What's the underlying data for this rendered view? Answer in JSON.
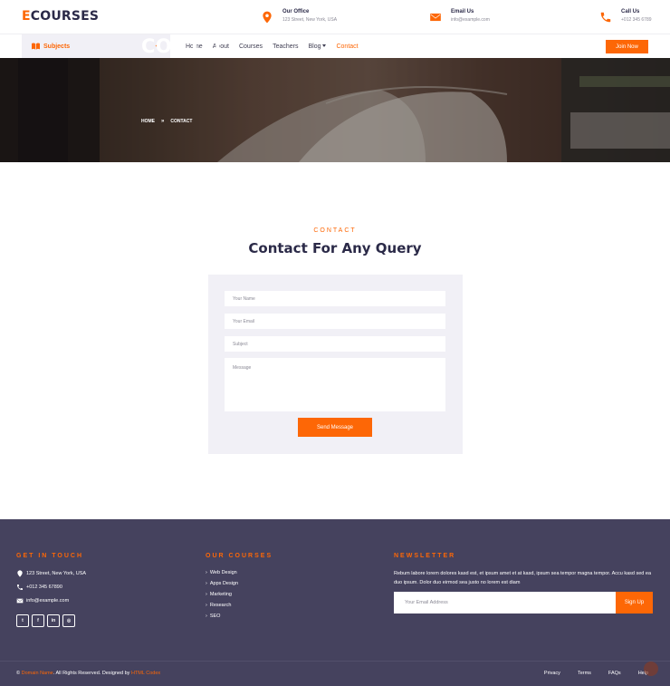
{
  "brand": {
    "first_letter": "E",
    "rest": "COURSES"
  },
  "topbar": {
    "office": {
      "title": "Our Office",
      "value": "123 Street, New York, USA",
      "icon": "map-marker-icon"
    },
    "email": {
      "title": "Email Us",
      "value": "info@example.com",
      "icon": "envelope-icon"
    },
    "call": {
      "title": "Call Us",
      "value": "+012 345 6789",
      "icon": "phone-icon"
    }
  },
  "nav": {
    "subjects_label": "Subjects",
    "items": [
      "Home",
      "About",
      "Courses",
      "Teachers",
      "Blog",
      "Contact"
    ],
    "active": "Contact",
    "join_label": "Join Now"
  },
  "hero": {
    "title": "CONTACT",
    "breadcrumb": [
      "HOME",
      "CONTACT"
    ]
  },
  "contact": {
    "eyebrow": "CONTACT",
    "heading": "Contact For Any Query",
    "name_placeholder": "Your Name",
    "email_placeholder": "Your Email",
    "subject_placeholder": "Subject",
    "message_placeholder": "Message",
    "send_label": "Send Message"
  },
  "footer": {
    "get_in_touch": {
      "title": "GET IN TOUCH",
      "address": "123 Street, New York, USA",
      "phone": "+012 345 67890",
      "email": "info@example.com"
    },
    "courses": {
      "title": "OUR COURSES",
      "items": [
        "Web Design",
        "Apps Design",
        "Marketing",
        "Research",
        "SEO"
      ]
    },
    "newsletter": {
      "title": "NEWSLETTER",
      "text": "Rebum labore lorem dolores kasd est, et ipsum amet et at kasd, ipsum sea tempor magna tempor. Accu kasd sed ea duo ipsum. Dolor duo eirmod sea justo no lorem est diam",
      "placeholder": "Your Email Address",
      "button": "Sign Up"
    },
    "copyright": {
      "prefix": "©",
      "domain": "Domain Name",
      "middle": ". All Rights Reserved. Designed by",
      "designer": "HTML Codex"
    },
    "links": [
      "Privacy",
      "Terms",
      "FAQs",
      "Help"
    ]
  },
  "colors": {
    "accent": "#fd6706",
    "dark": "#2b2a48",
    "footer_bg": "#45425e",
    "form_bg": "#f1f0f6"
  }
}
